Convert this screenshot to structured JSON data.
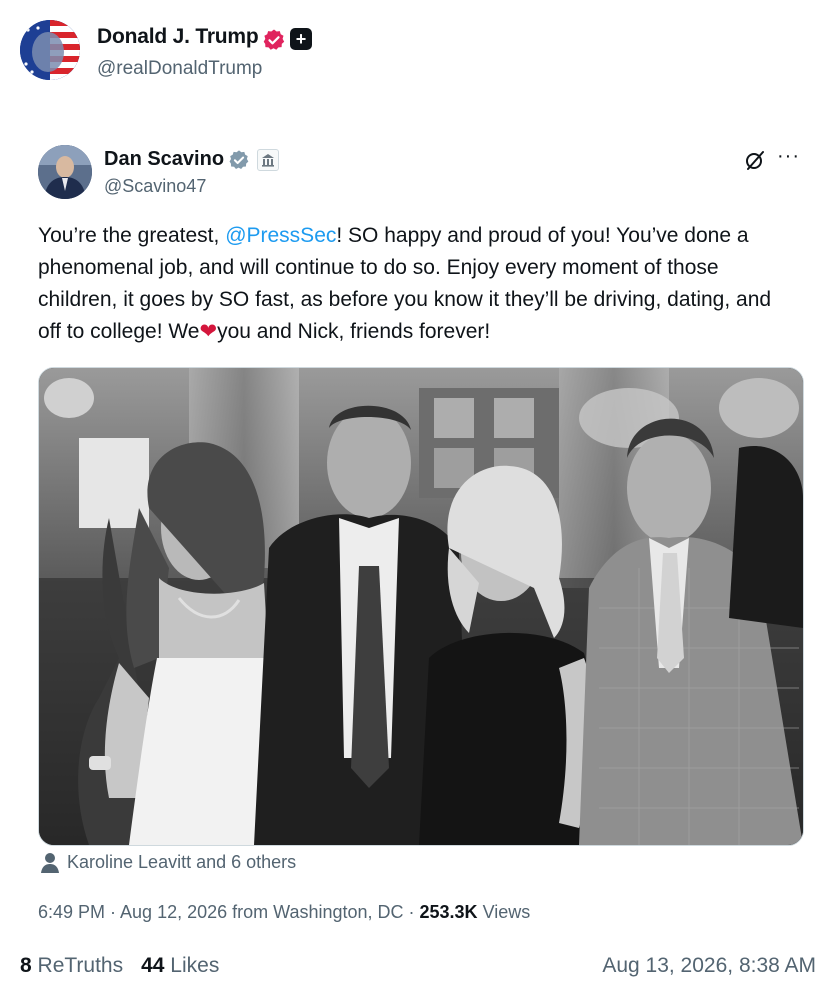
{
  "outer": {
    "name": "Donald J. Trump",
    "handle": "@realDonaldTrump",
    "avatar_icon": "flag-portrait-avatar",
    "badges": [
      "verified-badge-pink",
      "plus-badge"
    ]
  },
  "quoted": {
    "name": "Dan Scavino",
    "handle": "@Scavino47",
    "avatar_icon": "portrait-avatar",
    "badges": [
      "verified-badge-gray",
      "government-building-badge"
    ],
    "text_parts": {
      "p1": "You’re the greatest, ",
      "mention": "@PressSec",
      "p2": "! SO happy and proud of you! You’ve done a phenomenal job, and will continue to do so. Enjoy every moment of those children, it goes by SO fast, as before you know it they’ll be driving, dating, and off to college! We",
      "heart": "❤",
      "p3": "you and Nick, friends forever!"
    },
    "tagged": "Karoline Leavitt and 6 others",
    "time": "6:49 PM · Aug 12, 2026 from Washington, DC · ",
    "views_count": "253.3K",
    "views_label": " Views"
  },
  "stats": {
    "retruths_count": "8",
    "retruths_label": " ReTruths",
    "likes_count": "44",
    "likes_label": " Likes"
  },
  "timestamp": "Aug 13, 2026, 8:38 AM",
  "colors": {
    "mention": "#1d9bf0",
    "heart": "#d4163c",
    "verified_pink": "#e0245e",
    "verified_gray": "#829aab",
    "secondary_text": "#536471"
  }
}
